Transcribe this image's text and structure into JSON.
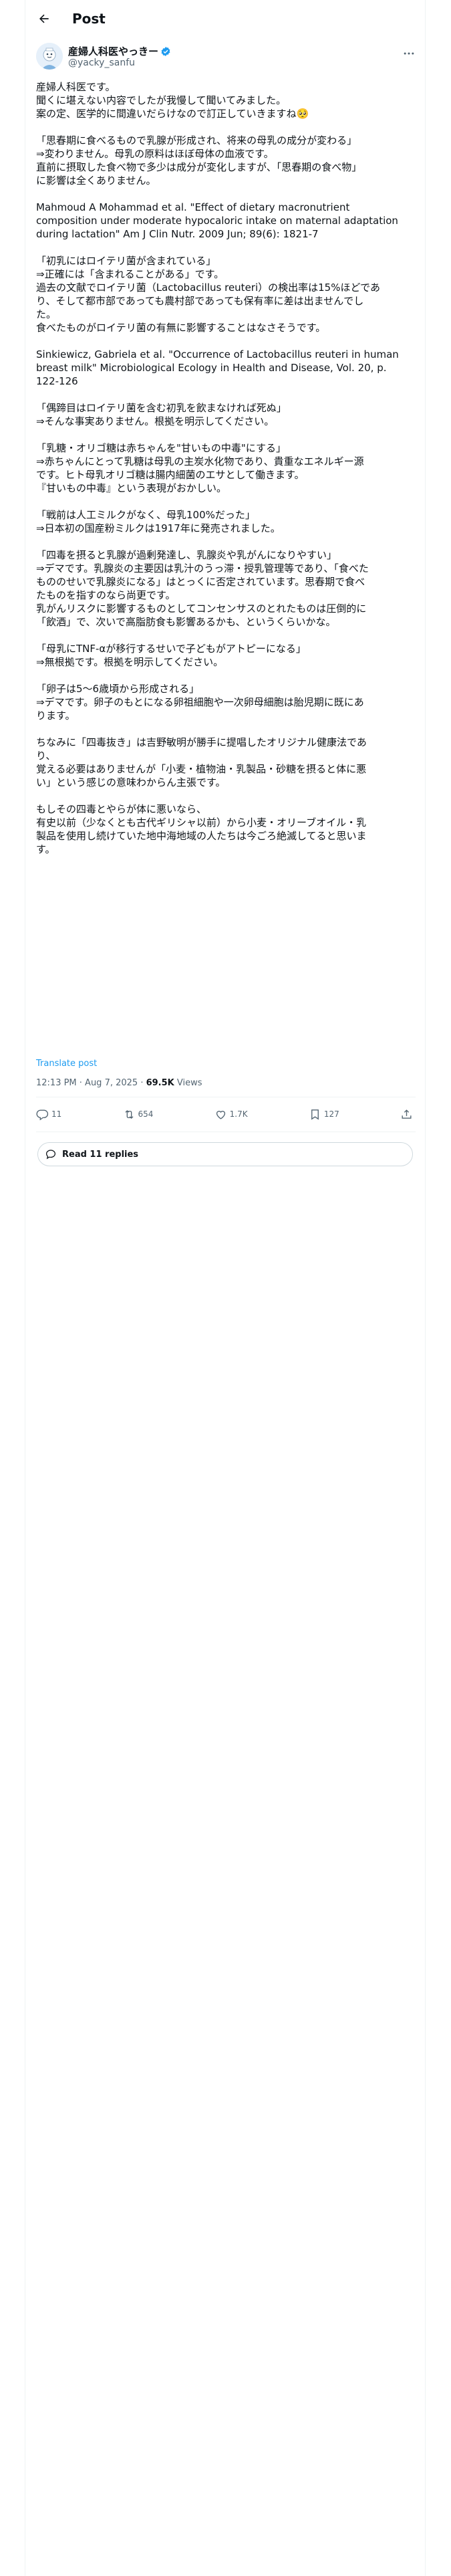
{
  "header": {
    "title": "Post",
    "back_icon": "arrow-left-icon"
  },
  "author": {
    "name": "産婦人科医やっきー",
    "handle": "@yacky_sanfu",
    "verified": true,
    "verified_color": "#1d9bf0"
  },
  "post_lines": [
    "産婦人科医です。",
    "聞くに堪えない内容でしたが我慢して聞いてみました。",
    "案の定、医学的に間違いだらけなので訂正していきますね🥺",
    "",
    "「思春期に食べるもので乳腺が形成され、将来の母乳の成分が変わる」",
    "⇒変わりません。母乳の原料はほぼ母体の血液です。",
    "直前に摂取した食べ物で多少は成分が変化しますが、「思春期の食べ物」",
    "に影響は全くありません。",
    "",
    "Mahmoud A Mohammad et al. \"Effect of dietary macronutrient",
    "composition under moderate hypocaloric intake on maternal adaptation",
    "during lactation\" Am J Clin Nutr. 2009 Jun; 89(6): 1821-7",
    "",
    "「初乳にはロイテリ菌が含まれている」",
    "⇒正確には「含まれることがある」です。",
    "過去の文献でロイテリ菌（Lactobacillus reuteri）の検出率は15%ほどであ",
    "り、そして都市部であっても農村部であっても保有率に差は出ませんでし",
    "た。",
    "食べたものがロイテリ菌の有無に影響することはなさそうです。",
    "",
    "Sinkiewicz, Gabriela et al. \"Occurrence of Lactobacillus reuteri in human",
    "breast milk\" Microbiological Ecology in Health and Disease, Vol. 20, p.",
    "122-126",
    "",
    "「偶蹄目はロイテリ菌を含む初乳を飲まなければ死ぬ」",
    "⇒そんな事実ありません。根拠を明示してください。",
    "",
    "「乳糖・オリゴ糖は赤ちゃんを\"甘いもの中毒\"にする」",
    "⇒赤ちゃんにとって乳糖は母乳の主炭水化物であり、貴重なエネルギー源",
    "です。ヒト母乳オリゴ糖は腸内細菌のエサとして働きます。",
    "『甘いもの中毒』という表現がおかしい。",
    "",
    "「戦前は人工ミルクがなく、母乳100%だった」",
    "⇒日本初の国産粉ミルクは1917年に発売されました。",
    "",
    "「四毒を摂ると乳腺が過剰発達し、乳腺炎や乳がんになりやすい」",
    "⇒デマです。乳腺炎の主要因は乳汁のうっ滞・授乳管理等であり、「食べた",
    "もののせいで乳腺炎になる」はとっくに否定されています。思春期で食べ",
    "たものを指すのなら尚更です。",
    "乳がんリスクに影響するものとしてコンセンサスのとれたものは圧倒的に",
    "「飲酒」で、次いで高脂肪食も影響あるかも、というくらいかな。",
    "",
    "「母乳にTNF-αが移行するせいで子どもがアトピーになる」",
    "⇒無根拠です。根拠を明示してください。",
    "",
    "「卵子は5〜6歳頃から形成される」",
    "⇒デマです。卵子のもとになる卵祖細胞や一次卵母細胞は胎児期に既にあ",
    "ります。",
    "",
    "ちなみに「四毒抜き」は吉野敏明が勝手に提唱したオリジナル健康法であ",
    "り、",
    "覚える必要はありませんが「小麦・植物油・乳製品・砂糖を摂ると体に悪",
    "い」という感じの意味わからん主張です。",
    "",
    "もしその四毒とやらが体に悪いなら、",
    "有史以前（少なくとも古代ギリシャ以前）から小麦・オリーブオイル・乳",
    "製品を使用し続けていた地中海地域の人たちは今ごろ絶滅してると思いま",
    "す。"
  ],
  "translate_label": "Translate post",
  "meta": {
    "time": "12:13 PM · Aug 7, 2025 · ",
    "views_count": "69.5K",
    "views_label": " Views"
  },
  "actions": {
    "replies": {
      "count": "11",
      "icon": "reply-icon"
    },
    "reposts": {
      "count": "654",
      "icon": "repost-icon"
    },
    "likes": {
      "count": "1.7K",
      "icon": "heart-icon"
    },
    "bookmarks": {
      "count": "127",
      "icon": "bookmark-icon"
    },
    "share": {
      "icon": "share-icon"
    }
  },
  "read_replies_label": "Read 11 replies"
}
